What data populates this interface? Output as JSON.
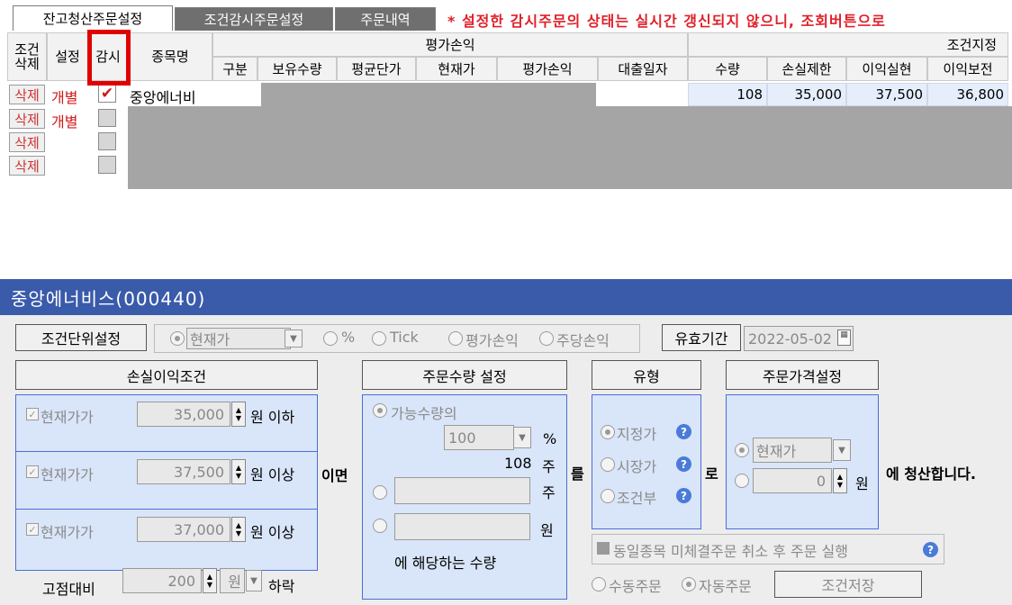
{
  "tabs": [
    "잔고청산주문설정",
    "조건감시주문설정",
    "주문내역"
  ],
  "notice": "* 설정한 감시주문의 상태는 실시간 갱신되지 않으니, 조회버튼으로",
  "grid": {
    "h_cond_delete": "조건 삭제",
    "h_setting": "설정",
    "h_watch": "감시",
    "h_name": "종목명",
    "h_eval_group": "평가손익",
    "h_cond_group": "조건지정",
    "h_type": "구분",
    "h_holding_qty": "보유수량",
    "h_avg_price": "평균단가",
    "h_cur_price": "현재가",
    "h_eval_pl": "평가손익",
    "h_loan_date": "대출일자",
    "h_qty": "수량",
    "h_stop_loss": "손실제한",
    "h_take_profit": "이익실현",
    "h_profit_keep": "이익보전",
    "delete_label": "삭제",
    "setting_label": "개별",
    "row1": {
      "name": "중앙에너비",
      "qty": "108",
      "stop_loss": "35,000",
      "take_profit": "37,500",
      "profit_keep": "36,800",
      "watch_mark": "✔"
    }
  },
  "title": "중앙에너비스(000440)",
  "unit": {
    "button": "조건단위설정",
    "cur_price": "현재가",
    "pct": "%",
    "tick": "Tick",
    "eval_pl": "평가손익",
    "per_share_pl": "주당손익",
    "valid_label": "유효기간",
    "valid_date": "2022-05-02"
  },
  "pl": {
    "header": "손실이익조건",
    "row1_label": "현재가가",
    "row1_value": "35,000",
    "row1_suffix": "원 이하",
    "row2_label": "현재가가",
    "row2_value": "37,500",
    "row2_suffix": "원 이상",
    "row3_label": "현재가가",
    "row3_value": "37,000",
    "row3_suffix": "원 이상",
    "fixed_label": "고점대비",
    "fixed_value": "200",
    "fixed_unit": "원",
    "fixed_suffix": "하락"
  },
  "imyeon": "이면",
  "qty": {
    "header": "주문수량 설정",
    "available_label": "가능수량의",
    "percent_value": "100",
    "pct_sign": "%",
    "shares_value": "108",
    "shares_unit": "주",
    "shares_unit2": "주",
    "won_unit": "원",
    "footer": "에 해당하는 수량"
  },
  "reul": "를",
  "otype": {
    "header": "유형",
    "limit": "지정가",
    "market": "시장가",
    "conditional": "조건부"
  },
  "ro": "로",
  "oprice": {
    "header": "주문가격설정",
    "cur_price": "현재가",
    "value": "0",
    "unit": "원"
  },
  "final": "에 청산합니다.",
  "same_cancel": "동일종목 미체결주문 취소 후 주문 실행",
  "manual": "수동주문",
  "auto": "자동주문",
  "save": "조건저장"
}
